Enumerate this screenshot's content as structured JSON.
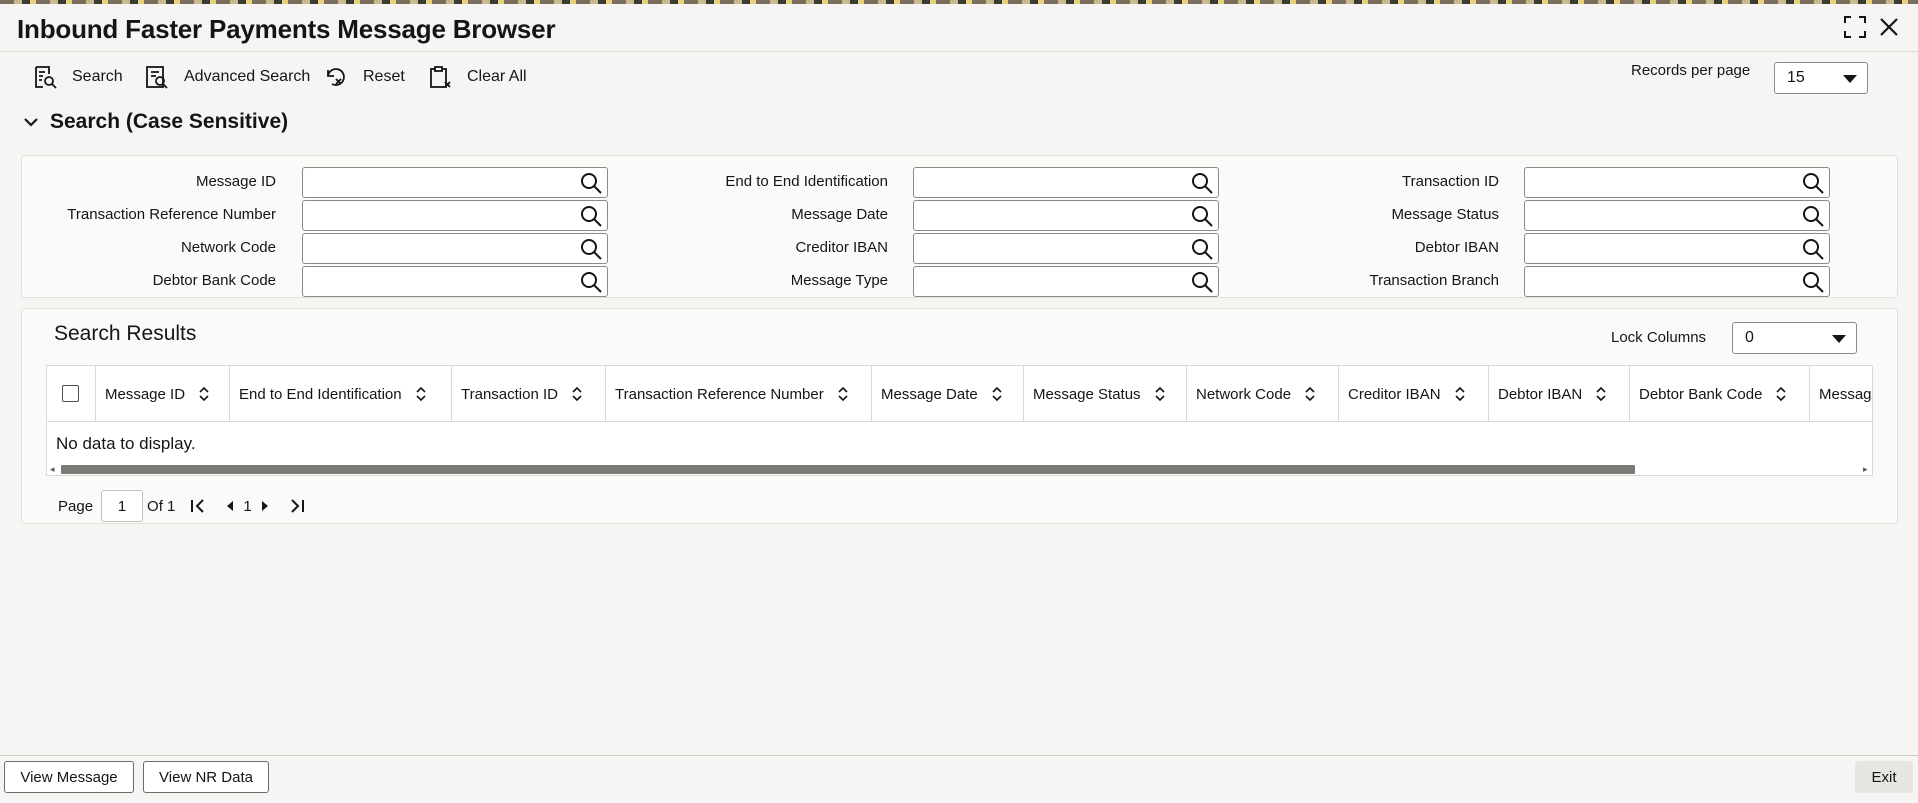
{
  "window": {
    "title": "Inbound Faster Payments Message Browser"
  },
  "toolbar": {
    "search_label": "Search",
    "advanced_search_label": "Advanced Search",
    "reset_label": "Reset",
    "clear_all_label": "Clear All",
    "records_per_page_label": "Records per page",
    "records_per_page_value": "15"
  },
  "search": {
    "heading": "Search (Case Sensitive)",
    "fields": {
      "message_id": "Message ID",
      "end_to_end_identification": "End to End Identification",
      "transaction_id": "Transaction ID",
      "transaction_reference_number": "Transaction Reference Number",
      "message_date": "Message Date",
      "message_status": "Message Status",
      "network_code": "Network Code",
      "creditor_iban": "Creditor IBAN",
      "debtor_iban": "Debtor IBAN",
      "debtor_bank_code": "Debtor Bank Code",
      "message_type": "Message Type",
      "transaction_branch": "Transaction Branch"
    }
  },
  "results": {
    "heading": "Search Results",
    "lock_columns_label": "Lock Columns",
    "lock_columns_value": "0",
    "columns": [
      "Message ID",
      "End to End Identification",
      "Transaction ID",
      "Transaction Reference Number",
      "Message Date",
      "Message Status",
      "Network Code",
      "Creditor IBAN",
      "Debtor IBAN",
      "Debtor Bank Code",
      "Message"
    ],
    "empty_text": "No data to display."
  },
  "pager": {
    "page_label": "Page",
    "page_value": "1",
    "of_label": "Of 1",
    "current": "1"
  },
  "footer": {
    "view_message": "View Message",
    "view_nr_data": "View NR Data",
    "exit": "Exit"
  }
}
